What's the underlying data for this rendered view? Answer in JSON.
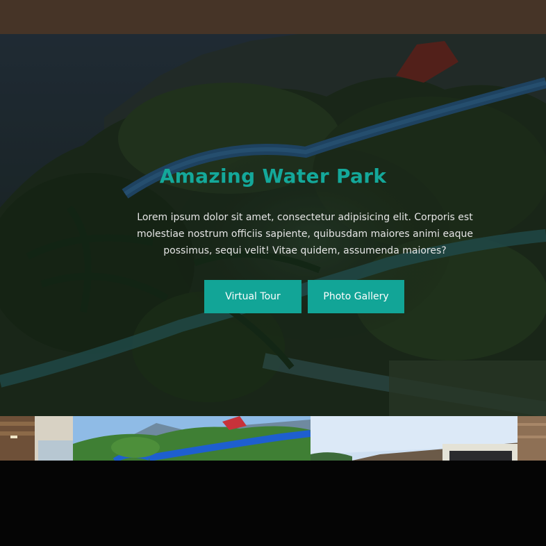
{
  "hero": {
    "title": "Amazing Water Park",
    "description": "Lorem ipsum dolor sit amet, consectetur adipisicing elit. Corporis est molestiae nostrum officiis sapiente, quibusdam maiores animi eaque possimus, sequi velit! Vitae quidem, assumenda maiores?",
    "buttons": {
      "virtual_tour": "Virtual Tour",
      "photo_gallery": "Photo Gallery"
    }
  },
  "colors": {
    "topbar": "#463427",
    "accent": "#12a597",
    "title": "#14a89a",
    "body_text": "#e6e6e6",
    "page_bottom": "#050505"
  }
}
